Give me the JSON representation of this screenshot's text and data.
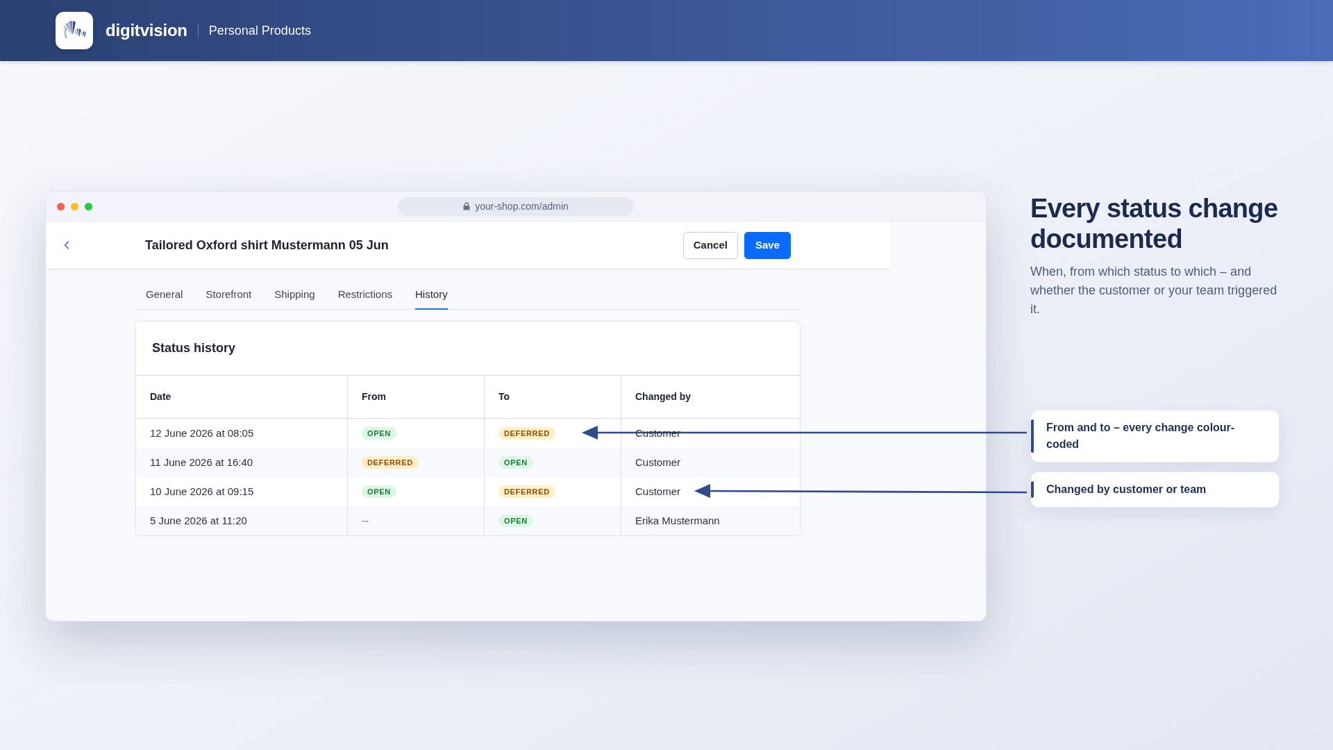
{
  "header": {
    "brand": "digitvision",
    "product": "Personal Products"
  },
  "browser": {
    "url": "your-shop.com/admin"
  },
  "page": {
    "title": "Tailored Oxford shirt Mustermann 05 Jun",
    "buttons": [
      {
        "label": "Cancel",
        "kind": "secondary"
      },
      {
        "label": "Save",
        "kind": "primary"
      }
    ]
  },
  "tabs": [
    {
      "label": "General",
      "selected": false
    },
    {
      "label": "Storefront",
      "selected": false
    },
    {
      "label": "Shipping",
      "selected": false
    },
    {
      "label": "Restrictions",
      "selected": false
    },
    {
      "label": "History",
      "selected": true
    }
  ],
  "status_history": {
    "title": "Status history",
    "columns": [
      "Date",
      "From",
      "To",
      "Changed by"
    ],
    "rows": [
      {
        "date": "12 June 2026 at 08:05",
        "from": {
          "label": "OPEN",
          "kind": "open"
        },
        "to": {
          "label": "DEFERRED",
          "kind": "deferred"
        },
        "changed_by": "Customer"
      },
      {
        "date": "11 June 2026 at 16:40",
        "from": {
          "label": "DEFERRED",
          "kind": "deferred"
        },
        "to": {
          "label": "OPEN",
          "kind": "open"
        },
        "changed_by": "Customer"
      },
      {
        "date": "10 June 2026 at 09:15",
        "from": {
          "label": "OPEN",
          "kind": "open"
        },
        "to": {
          "label": "DEFERRED",
          "kind": "deferred"
        },
        "changed_by": "Customer"
      },
      {
        "date": "5 June 2026 at 11:20",
        "from": {
          "label": "--",
          "kind": "text"
        },
        "to": {
          "label": "OPEN",
          "kind": "open"
        },
        "changed_by": "Erika Mustermann"
      }
    ]
  },
  "feature": {
    "heading": "Every status change documented",
    "description": "When, from which status to which – and whether the customer or your team triggered it."
  },
  "callouts": [
    {
      "text": "From and to – every change colour-coded"
    },
    {
      "text": "Changed by customer or team"
    }
  ]
}
